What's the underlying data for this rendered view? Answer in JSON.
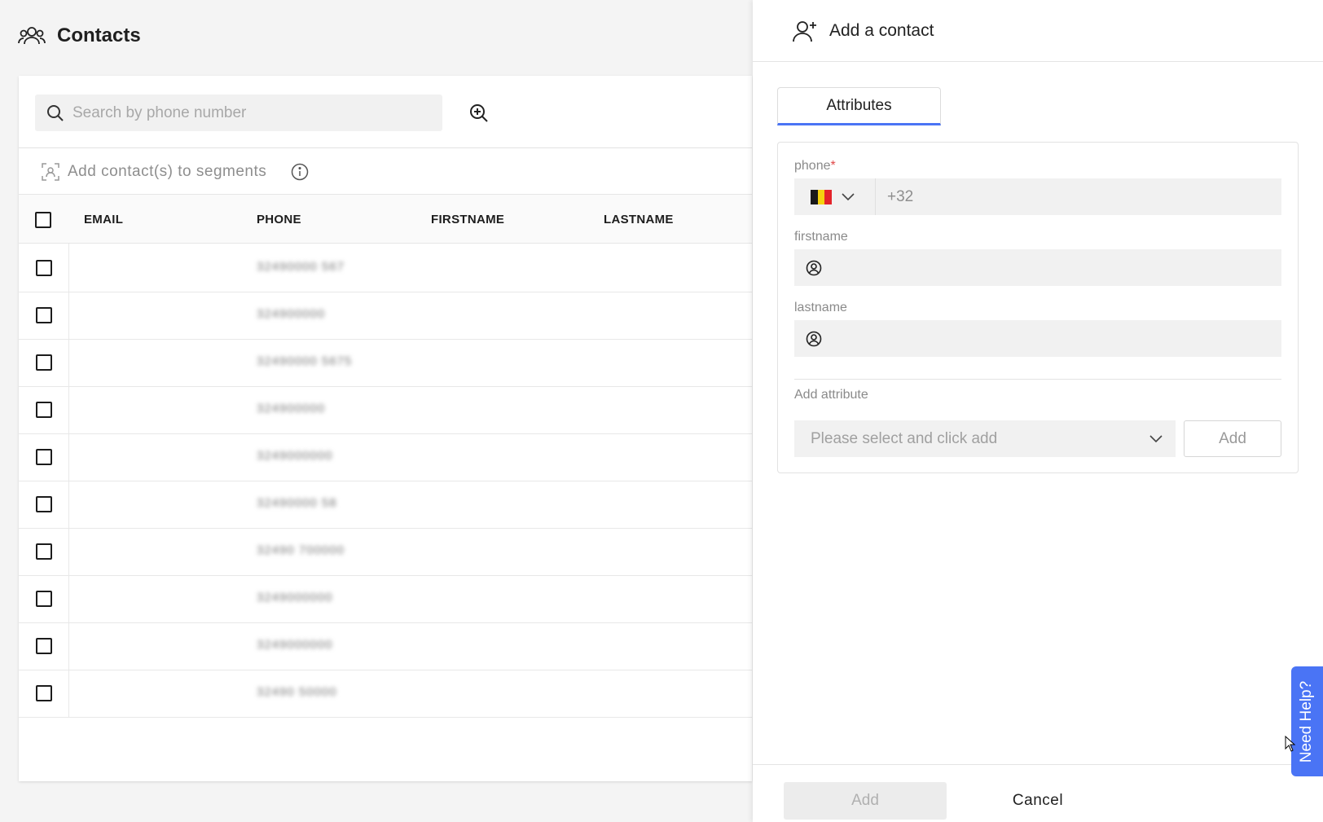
{
  "page": {
    "title": "Contacts"
  },
  "search": {
    "placeholder": "Search by phone number"
  },
  "segments": {
    "label": "Add contact(s) to segments"
  },
  "table": {
    "columns": [
      "EMAIL",
      "PHONE",
      "FIRSTNAME",
      "LASTNAME"
    ],
    "rows": [
      {
        "phone": "32490000 567"
      },
      {
        "phone": "324900000"
      },
      {
        "phone": "32490000 5675"
      },
      {
        "phone": "324900000"
      },
      {
        "phone": "3249000000"
      },
      {
        "phone": "32490000 58"
      },
      {
        "phone": "32490 700000"
      },
      {
        "phone": "3249000000"
      },
      {
        "phone": "3249000000"
      },
      {
        "phone": "32490 50000"
      }
    ]
  },
  "panel": {
    "title": "Add a contact",
    "tab": "Attributes",
    "phone_label": "phone",
    "phone_required": "*",
    "phone_prefix": "+32",
    "flag_colors": [
      "#1a1a1a",
      "#f5d20f",
      "#e3232a"
    ],
    "firstname_label": "firstname",
    "lastname_label": "lastname",
    "add_attribute_label": "Add attribute",
    "attribute_select_value": "Please select and click add",
    "add_attribute_button": "Add",
    "footer_add": "Add",
    "footer_cancel": "Cancel"
  },
  "help": {
    "label": "Need Help?"
  },
  "colors": {
    "accent": "#4a74f5",
    "required": "#e04848"
  }
}
